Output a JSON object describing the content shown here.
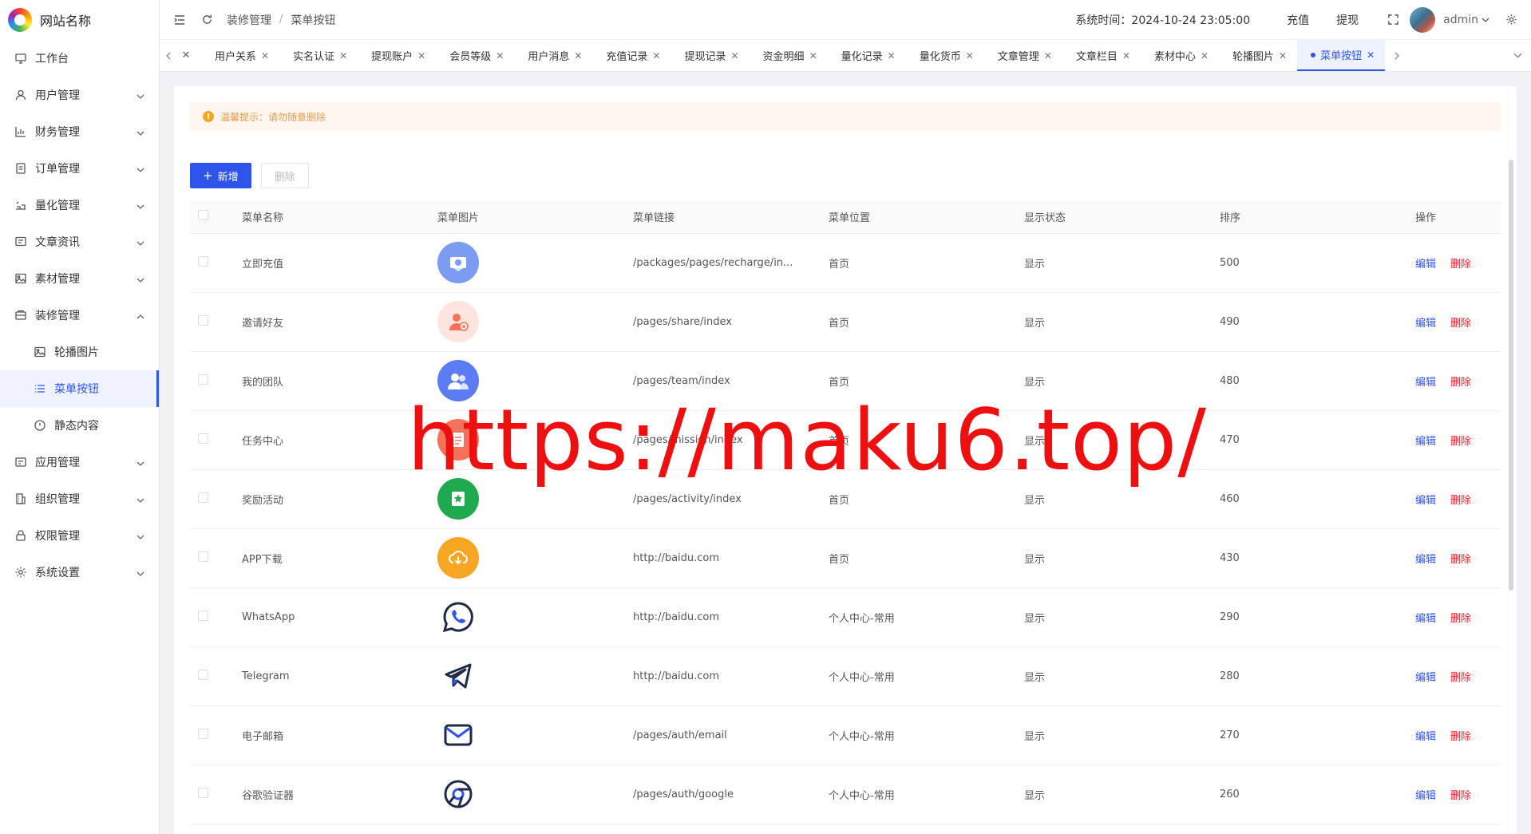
{
  "app": {
    "site_name": "网站名称"
  },
  "colors": {
    "accent": "#2f54eb",
    "danger": "#f5222d",
    "warning": "#f5a623",
    "watermark": "#ee1010"
  },
  "sidebar": {
    "items": [
      {
        "label": "工作台",
        "icon": "monitor-icon"
      },
      {
        "label": "用户管理",
        "icon": "user-icon",
        "expandable": true
      },
      {
        "label": "财务管理",
        "icon": "chart-icon",
        "expandable": true
      },
      {
        "label": "订单管理",
        "icon": "order-icon",
        "expandable": true
      },
      {
        "label": "量化管理",
        "icon": "quant-icon",
        "expandable": true
      },
      {
        "label": "文章资讯",
        "icon": "article-icon",
        "expandable": true
      },
      {
        "label": "素材管理",
        "icon": "image-icon",
        "expandable": true
      },
      {
        "label": "装修管理",
        "icon": "decor-icon",
        "expandable": true,
        "expanded": true
      },
      {
        "label": "轮播图片",
        "icon": "image-icon",
        "sub": true
      },
      {
        "label": "菜单按钮",
        "icon": "list-icon",
        "sub": true,
        "active": true
      },
      {
        "label": "静态内容",
        "icon": "info-icon",
        "sub": true
      },
      {
        "label": "应用管理",
        "icon": "app-icon",
        "expandable": true
      },
      {
        "label": "组织管理",
        "icon": "org-icon",
        "expandable": true
      },
      {
        "label": "权限管理",
        "icon": "lock-icon",
        "expandable": true
      },
      {
        "label": "系统设置",
        "icon": "gear-icon",
        "expandable": true
      }
    ]
  },
  "header": {
    "breadcrumb": [
      "装修管理",
      "菜单按钮"
    ],
    "breadcrumb_sep": "/",
    "system_time": "系统时间：2024-10-24 23:05:00",
    "recharge": "充值",
    "withdraw": "提现",
    "user_name": "admin"
  },
  "tabs": [
    {
      "label": "用户关系"
    },
    {
      "label": "实名认证"
    },
    {
      "label": "提现账户"
    },
    {
      "label": "会员等级"
    },
    {
      "label": "用户消息"
    },
    {
      "label": "充值记录"
    },
    {
      "label": "提现记录"
    },
    {
      "label": "资金明细"
    },
    {
      "label": "量化记录"
    },
    {
      "label": "量化货币"
    },
    {
      "label": "文章管理"
    },
    {
      "label": "文章栏目"
    },
    {
      "label": "素材中心"
    },
    {
      "label": "轮播图片"
    },
    {
      "label": "菜单按钮",
      "active": true
    }
  ],
  "main": {
    "alert": "温馨提示：请勿随意删除",
    "add_button": "新增",
    "delete_button": "删除",
    "table": {
      "columns": [
        "菜单名称",
        "菜单图片",
        "菜单链接",
        "菜单位置",
        "显示状态",
        "排序",
        "操作"
      ],
      "edit_label": "编辑",
      "delete_label": "删除",
      "rows": [
        {
          "name": "立即充值",
          "icon": "recharge-icon",
          "link": "/packages/pages/recharge/in...",
          "position": "首页",
          "status": "显示",
          "sort": "500"
        },
        {
          "name": "邀请好友",
          "icon": "invite-icon",
          "link": "/pages/share/index",
          "position": "首页",
          "status": "显示",
          "sort": "490"
        },
        {
          "name": "我的团队",
          "icon": "team-icon",
          "link": "/pages/team/index",
          "position": "首页",
          "status": "显示",
          "sort": "480"
        },
        {
          "name": "任务中心",
          "icon": "task-icon",
          "link": "/pages/mission/index",
          "position": "首页",
          "status": "显示",
          "sort": "470"
        },
        {
          "name": "奖励活动",
          "icon": "activity-icon",
          "link": "/pages/activity/index",
          "position": "首页",
          "status": "显示",
          "sort": "460"
        },
        {
          "name": "APP下载",
          "icon": "download-icon",
          "link": "http://baidu.com",
          "position": "首页",
          "status": "显示",
          "sort": "430"
        },
        {
          "name": "WhatsApp",
          "icon": "whatsapp-icon",
          "link": "http://baidu.com",
          "position": "个人中心-常用",
          "status": "显示",
          "sort": "290"
        },
        {
          "name": "Telegram",
          "icon": "telegram-icon",
          "link": "http://baidu.com",
          "position": "个人中心-常用",
          "status": "显示",
          "sort": "280"
        },
        {
          "name": "电子邮箱",
          "icon": "email-icon",
          "link": "/pages/auth/email",
          "position": "个人中心-常用",
          "status": "显示",
          "sort": "270"
        },
        {
          "name": "谷歌验证器",
          "icon": "google-icon",
          "link": "/pages/auth/google",
          "position": "个人中心-常用",
          "status": "显示",
          "sort": "260"
        }
      ]
    }
  },
  "watermark": "https://maku6.top/"
}
